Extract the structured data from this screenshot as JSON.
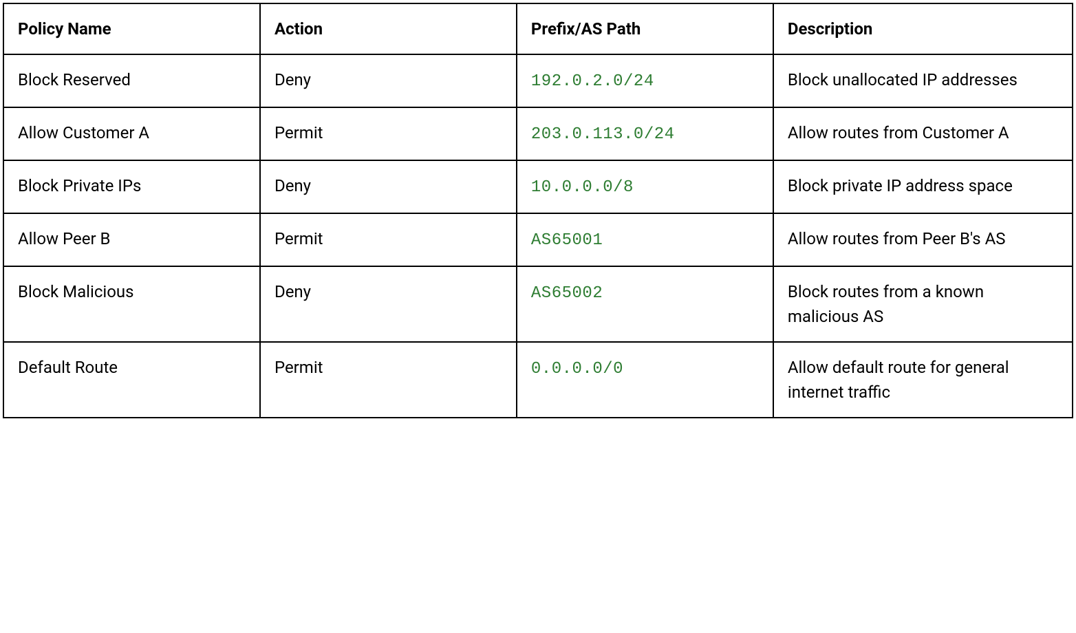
{
  "table": {
    "headers": {
      "policy_name": "Policy Name",
      "action": "Action",
      "prefix": "Prefix/AS Path",
      "description": "Description"
    },
    "rows": [
      {
        "policy_name": "Block Reserved",
        "action": "Deny",
        "prefix": "192.0.2.0/24",
        "description": "Block unallocated IP addresses"
      },
      {
        "policy_name": "Allow Customer A",
        "action": "Permit",
        "prefix": "203.0.113.0/24",
        "description": "Allow routes from Customer A"
      },
      {
        "policy_name": "Block Private IPs",
        "action": "Deny",
        "prefix": "10.0.0.0/8",
        "description": "Block private IP address space"
      },
      {
        "policy_name": "Allow Peer B",
        "action": "Permit",
        "prefix": "AS65001",
        "description": "Allow routes from Peer B's AS"
      },
      {
        "policy_name": "Block Malicious",
        "action": "Deny",
        "prefix": "AS65002",
        "description": "Block routes from a known malicious AS"
      },
      {
        "policy_name": "Default Route",
        "action": "Permit",
        "prefix": "0.0.0.0/0",
        "description": "Allow default route for general internet traffic"
      }
    ]
  }
}
